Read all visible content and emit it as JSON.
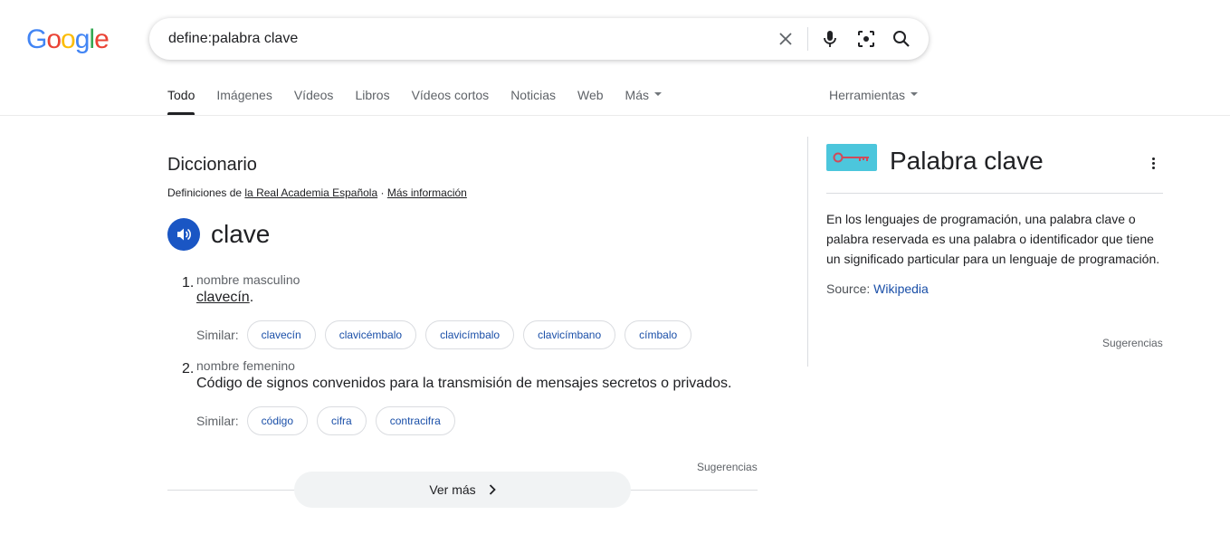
{
  "logo": {
    "letters": [
      "G",
      "o",
      "o",
      "g",
      "l",
      "e"
    ],
    "colors": [
      "#4285F4",
      "#EA4335",
      "#FBBC05",
      "#4285F4",
      "#34A853",
      "#EA4335"
    ]
  },
  "search": {
    "query": "define:palabra clave"
  },
  "tabs": [
    {
      "label": "Todo",
      "active": true
    },
    {
      "label": "Imágenes"
    },
    {
      "label": "Vídeos"
    },
    {
      "label": "Libros"
    },
    {
      "label": "Vídeos cortos"
    },
    {
      "label": "Noticias"
    },
    {
      "label": "Web"
    },
    {
      "label": "Más"
    }
  ],
  "tools": {
    "label": "Herramientas"
  },
  "dictionary": {
    "title": "Diccionario",
    "source_prefix": "Definiciones de ",
    "source_link": "la Real Academia Española",
    "source_sep": " · ",
    "more_info": "Más información",
    "word": "clave",
    "senses": [
      {
        "num": "1.",
        "pos": "nombre masculino",
        "definition": "clavecín",
        "definition_end": ".",
        "similar_label": "Similar:",
        "similar": [
          "clavecín",
          "clavicémbalo",
          "clavicímbalo",
          "clavicímbano",
          "címbalo"
        ]
      },
      {
        "num": "2.",
        "pos": "nombre femenino",
        "definition": "Código de signos convenidos para la transmisión de mensajes secretos o privados.",
        "similar_label": "Similar:",
        "similar": [
          "código",
          "cifra",
          "contracifra"
        ]
      }
    ],
    "suggestions": "Sugerencias",
    "see_more": "Ver más"
  },
  "knowledge_panel": {
    "title": "Palabra clave",
    "description": "En los lenguajes de programación, una palabra clave o palabra reservada es una palabra o identificador que tiene un significado particular para un lenguaje de programación.",
    "source_label": "Source: ",
    "source_link": "Wikipedia",
    "suggestions": "Sugerencias"
  },
  "icons": {
    "clear": "close-icon",
    "voice": "microphone-icon",
    "lens": "lens-icon",
    "search": "search-icon",
    "speaker": "speaker-icon",
    "chevron": "chevron-right-icon",
    "menu": "more-vert-icon",
    "thumb": "key-icon"
  }
}
